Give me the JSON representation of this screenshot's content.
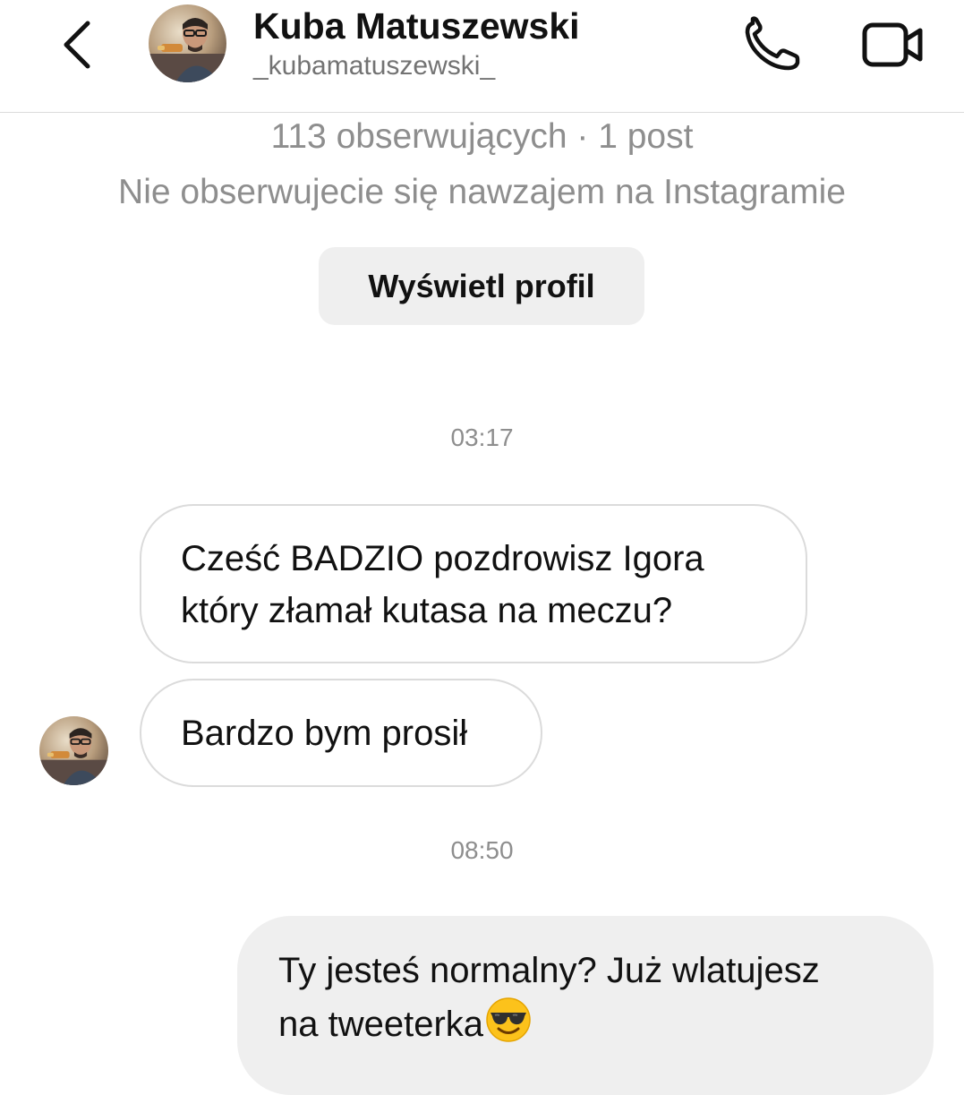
{
  "header": {
    "back_icon": "chevron-left-icon",
    "name": "Kuba Matuszewski",
    "handle": "_kubamatuszewski_",
    "call_icon": "phone-icon",
    "video_icon": "video-camera-icon"
  },
  "profile": {
    "stats": "113 obserwujących · 1 post",
    "mutual": "Nie obserwujecie się nawzajem na Instagramie",
    "view_profile_label": "Wyświetl profil"
  },
  "conversation": {
    "timestamp_1": "03:17",
    "messages_in": [
      {
        "line1": "Cześć BADZIO pozdrowisz Igora",
        "line2": "który złamał kutasa na meczu?"
      },
      {
        "line1": "Bardzo bym prosił"
      }
    ],
    "timestamp_2": "08:50",
    "message_out": {
      "line1": "Ty jesteś normalny? Już wlatujesz",
      "line2": "na tweeterka",
      "emoji": "smiling-face-with-sunglasses-icon"
    }
  }
}
